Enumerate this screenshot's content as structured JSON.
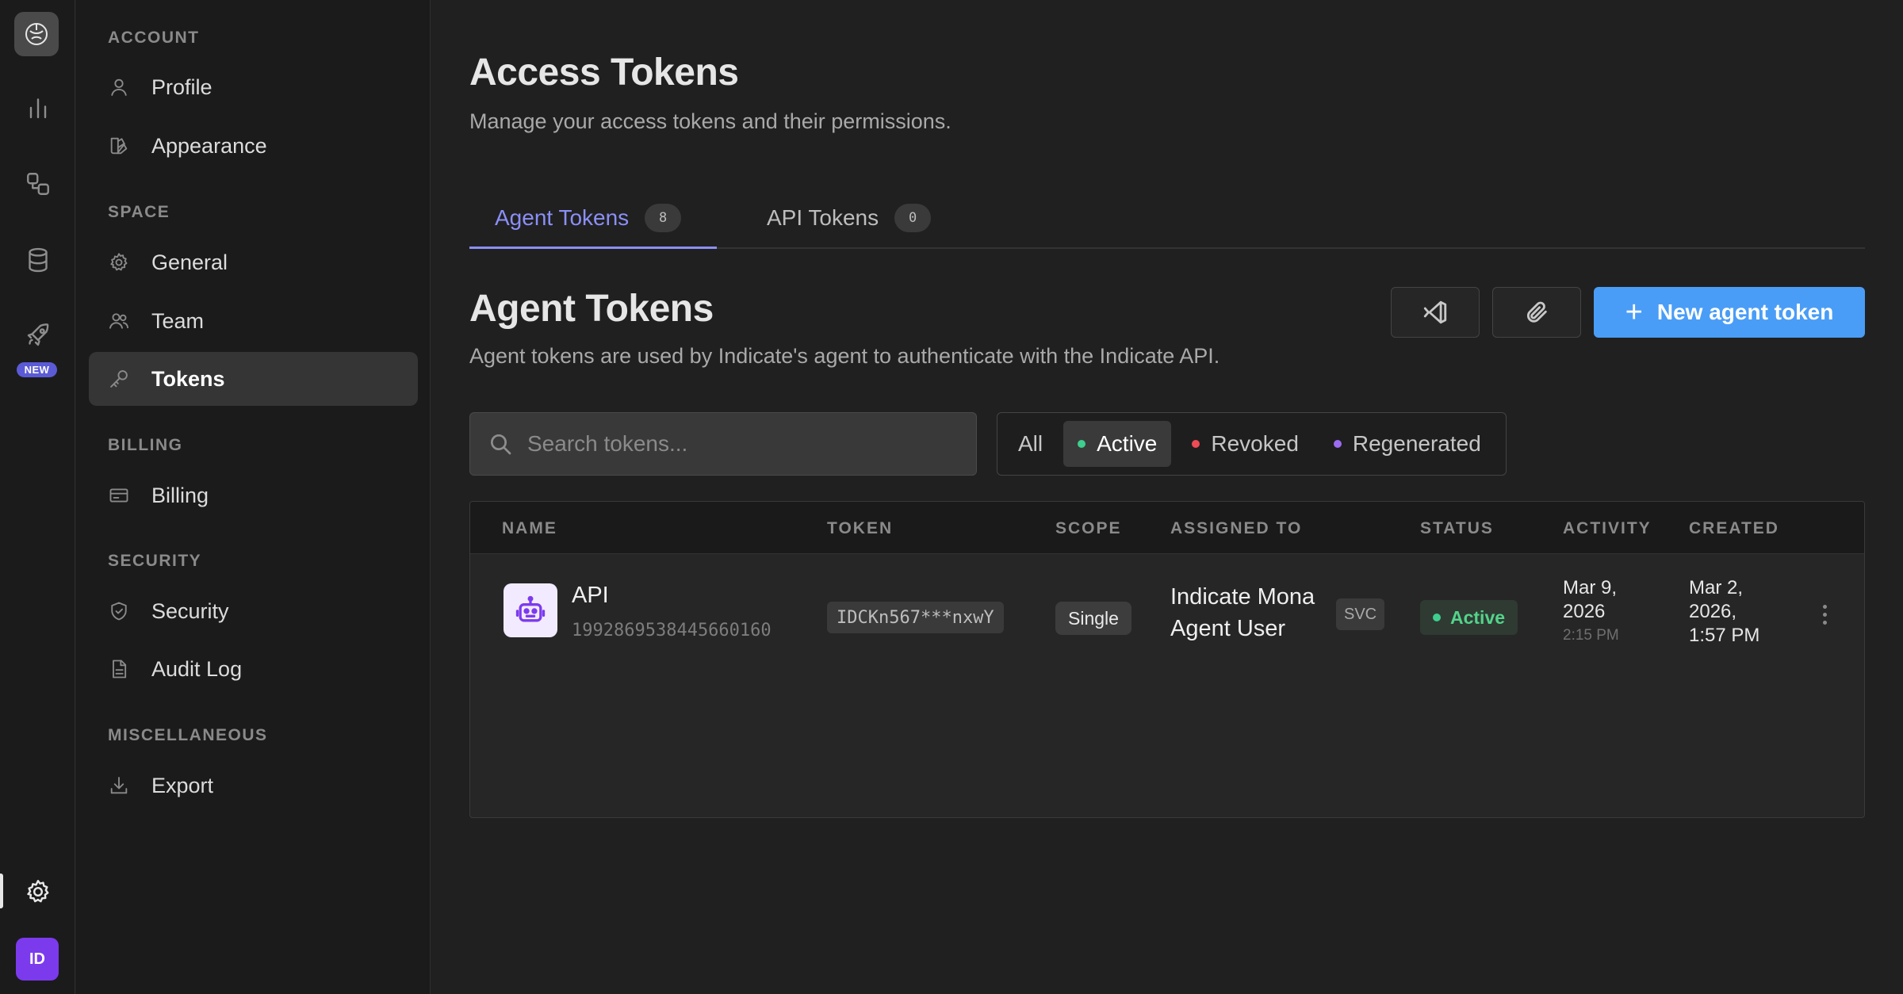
{
  "rail": {
    "new_badge": "NEW",
    "avatar_initials": "ID"
  },
  "sidebar": {
    "sections": [
      {
        "title": "ACCOUNT",
        "items": [
          {
            "label": "Profile",
            "icon": "user-icon"
          },
          {
            "label": "Appearance",
            "icon": "palette-icon"
          }
        ]
      },
      {
        "title": "SPACE",
        "items": [
          {
            "label": "General",
            "icon": "gear-icon"
          },
          {
            "label": "Team",
            "icon": "users-icon"
          },
          {
            "label": "Tokens",
            "icon": "key-icon",
            "active": true
          }
        ]
      },
      {
        "title": "BILLING",
        "items": [
          {
            "label": "Billing",
            "icon": "credit-card-icon"
          }
        ]
      },
      {
        "title": "SECURITY",
        "items": [
          {
            "label": "Security",
            "icon": "shield-icon"
          },
          {
            "label": "Audit Log",
            "icon": "document-icon"
          }
        ]
      },
      {
        "title": "MISCELLANEOUS",
        "items": [
          {
            "label": "Export",
            "icon": "download-icon"
          }
        ]
      }
    ]
  },
  "header": {
    "title": "Access Tokens",
    "subtitle": "Manage your access tokens and their permissions."
  },
  "tabs": [
    {
      "label": "Agent Tokens",
      "count": "8",
      "active": true
    },
    {
      "label": "API Tokens",
      "count": "0",
      "active": false
    }
  ],
  "section": {
    "title": "Agent Tokens",
    "subtitle": "Agent tokens are used by Indicate's agent to authenticate with the Indicate API.",
    "new_button": "New agent token"
  },
  "search": {
    "placeholder": "Search tokens..."
  },
  "filters": [
    {
      "label": "All",
      "active": false
    },
    {
      "label": "Active",
      "active": true,
      "dot": "#3ecf8e"
    },
    {
      "label": "Revoked",
      "active": false,
      "dot": "#ef4b57"
    },
    {
      "label": "Regenerated",
      "active": false,
      "dot": "#9b6cf2"
    }
  ],
  "table": {
    "columns": [
      "NAME",
      "TOKEN",
      "SCOPE",
      "ASSIGNED TO",
      "STATUS",
      "ACTIVITY",
      "CREATED"
    ],
    "rows": [
      {
        "name": "API",
        "id": "1992869538445660160",
        "token": "IDCKn567***nxwY",
        "scope": "Single",
        "assigned_line1": "Indicate Mona",
        "assigned_line2": "Agent User",
        "assigned_badge": "SVC",
        "status": "Active",
        "activity_date_1": "Mar 9,",
        "activity_date_2": "2026",
        "activity_time": "2:15 PM",
        "created_1": "Mar 2,",
        "created_2": "2026,",
        "created_3": "1:57 PM"
      }
    ]
  },
  "colors": {
    "accent": "#8b8ff7",
    "primary_button": "#4a9df6",
    "status_active": "#54d38a"
  }
}
